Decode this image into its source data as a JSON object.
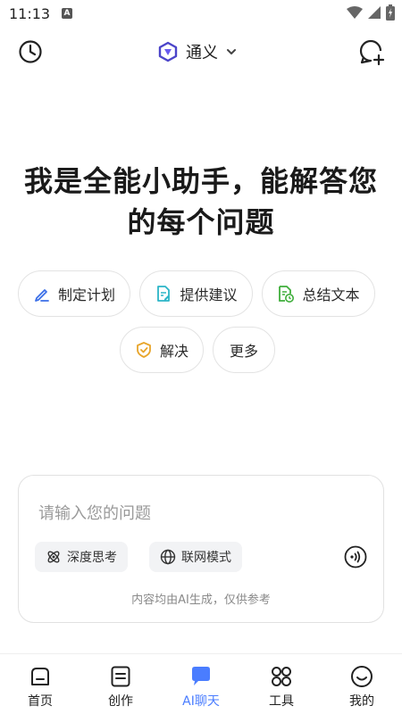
{
  "status_bar": {
    "time": "11:13",
    "notification_letter": "A"
  },
  "header": {
    "app_name": "通义"
  },
  "headline": {
    "line1": "我是全能小助手，能解答您",
    "line2": "的每个问题"
  },
  "suggestions": [
    {
      "label": "制定计划",
      "icon": "pen-icon"
    },
    {
      "label": "提供建议",
      "icon": "document-edit-icon"
    },
    {
      "label": "总结文本",
      "icon": "document-clock-icon"
    },
    {
      "label": "解决",
      "icon": "shield-check-icon"
    },
    {
      "label": "更多",
      "icon": ""
    }
  ],
  "composer": {
    "placeholder": "请输入您的问题",
    "deep_think_label": "深度思考",
    "web_mode_label": "联网模式",
    "disclaimer": "内容均由AI生成，仅供参考"
  },
  "bottom_nav": [
    {
      "label": "首页",
      "icon": "home-icon",
      "active": false
    },
    {
      "label": "创作",
      "icon": "create-icon",
      "active": false
    },
    {
      "label": "AI聊天",
      "icon": "chat-bubble-icon",
      "active": true
    },
    {
      "label": "工具",
      "icon": "grid-icon",
      "active": false
    },
    {
      "label": "我的",
      "icon": "smile-icon",
      "active": false
    }
  ],
  "colors": {
    "accent": "#4a7dff",
    "chip_border": "#e3e3e3",
    "blue_icon": "#3b6fe8",
    "teal_icon": "#2bb5c7",
    "green_icon": "#3fae3b",
    "amber_icon": "#e8a52b"
  }
}
